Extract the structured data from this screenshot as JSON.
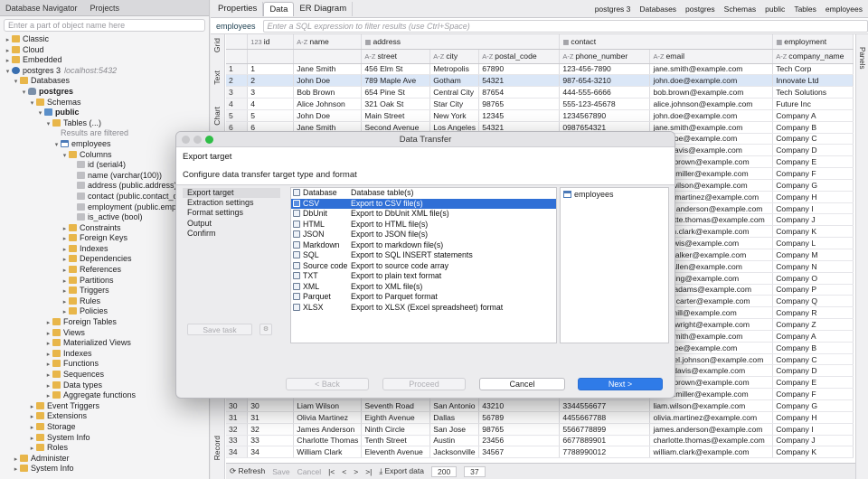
{
  "nav": {
    "tab_label": "Database Navigator",
    "tab2_label": "Projects",
    "search_placeholder": "Enter a part of object name here",
    "items": [
      {
        "depth": 0,
        "arrow": "▸",
        "icon": "folder",
        "label": "Classic",
        "interactable": true
      },
      {
        "depth": 0,
        "arrow": "▸",
        "icon": "folder",
        "label": "Cloud",
        "interactable": true
      },
      {
        "depth": 0,
        "arrow": "▸",
        "icon": "folder",
        "label": "Embedded",
        "interactable": true
      },
      {
        "depth": 0,
        "arrow": "▾",
        "icon": "conn",
        "label": "postgres 3",
        "extra": "localhost:5432",
        "interactable": true
      },
      {
        "depth": 1,
        "arrow": "▾",
        "icon": "folder",
        "label": "Databases",
        "interactable": true
      },
      {
        "depth": 2,
        "arrow": "▾",
        "icon": "db",
        "label": "postgres",
        "bold": true,
        "interactable": true
      },
      {
        "depth": 3,
        "arrow": "▾",
        "icon": "folder",
        "label": "Schemas",
        "interactable": true
      },
      {
        "depth": 4,
        "arrow": "▾",
        "icon": "schema",
        "label": "public",
        "bold": true,
        "interactable": true
      },
      {
        "depth": 5,
        "arrow": "▾",
        "icon": "folder",
        "label": "Tables (...)",
        "interactable": true
      },
      {
        "depth": 6,
        "arrow": "",
        "icon": "none",
        "label": "Results are filtered",
        "muted": true,
        "interactable": false
      },
      {
        "depth": 6,
        "arrow": "▾",
        "icon": "table",
        "label": "employees",
        "interactable": true
      },
      {
        "depth": 7,
        "arrow": "▾",
        "icon": "folder",
        "label": "Columns",
        "interactable": true
      },
      {
        "depth": 8,
        "arrow": "",
        "icon": "col",
        "label": "id (serial4)",
        "interactable": true
      },
      {
        "depth": 8,
        "arrow": "",
        "icon": "col",
        "label": "name (varchar(100))",
        "interactable": true
      },
      {
        "depth": 8,
        "arrow": "",
        "icon": "col",
        "label": "address (public.address)",
        "interactable": true
      },
      {
        "depth": 8,
        "arrow": "",
        "icon": "col",
        "label": "contact (public.contact_c",
        "interactable": true
      },
      {
        "depth": 8,
        "arrow": "",
        "icon": "col",
        "label": "employment (public.emplo",
        "interactable": true
      },
      {
        "depth": 8,
        "arrow": "",
        "icon": "col",
        "label": "is_active (bool)",
        "interactable": true
      },
      {
        "depth": 7,
        "arrow": "▸",
        "icon": "folder",
        "label": "Constraints",
        "interactable": true
      },
      {
        "depth": 7,
        "arrow": "▸",
        "icon": "folder",
        "label": "Foreign Keys",
        "interactable": true
      },
      {
        "depth": 7,
        "arrow": "▸",
        "icon": "folder",
        "label": "Indexes",
        "interactable": true
      },
      {
        "depth": 7,
        "arrow": "▸",
        "icon": "folder",
        "label": "Dependencies",
        "interactable": true
      },
      {
        "depth": 7,
        "arrow": "▸",
        "icon": "folder",
        "label": "References",
        "interactable": true
      },
      {
        "depth": 7,
        "arrow": "▸",
        "icon": "folder",
        "label": "Partitions",
        "interactable": true
      },
      {
        "depth": 7,
        "arrow": "▸",
        "icon": "folder",
        "label": "Triggers",
        "interactable": true
      },
      {
        "depth": 7,
        "arrow": "▸",
        "icon": "folder",
        "label": "Rules",
        "interactable": true
      },
      {
        "depth": 7,
        "arrow": "▸",
        "icon": "folder",
        "label": "Policies",
        "interactable": true
      },
      {
        "depth": 5,
        "arrow": "▸",
        "icon": "folder",
        "label": "Foreign Tables",
        "interactable": true
      },
      {
        "depth": 5,
        "arrow": "▸",
        "icon": "folder",
        "label": "Views",
        "interactable": true
      },
      {
        "depth": 5,
        "arrow": "▸",
        "icon": "folder",
        "label": "Materialized Views",
        "interactable": true
      },
      {
        "depth": 5,
        "arrow": "▸",
        "icon": "folder",
        "label": "Indexes",
        "interactable": true
      },
      {
        "depth": 5,
        "arrow": "▸",
        "icon": "folder",
        "label": "Functions",
        "interactable": true
      },
      {
        "depth": 5,
        "arrow": "▸",
        "icon": "folder",
        "label": "Sequences",
        "interactable": true
      },
      {
        "depth": 5,
        "arrow": "▸",
        "icon": "folder",
        "label": "Data types",
        "interactable": true
      },
      {
        "depth": 5,
        "arrow": "▸",
        "icon": "folder",
        "label": "Aggregate functions",
        "interactable": true
      },
      {
        "depth": 3,
        "arrow": "▸",
        "icon": "folder",
        "label": "Event Triggers",
        "interactable": true
      },
      {
        "depth": 3,
        "arrow": "▸",
        "icon": "folder",
        "label": "Extensions",
        "interactable": true
      },
      {
        "depth": 3,
        "arrow": "▸",
        "icon": "folder",
        "label": "Storage",
        "interactable": true
      },
      {
        "depth": 3,
        "arrow": "▸",
        "icon": "folder",
        "label": "System Info",
        "interactable": true
      },
      {
        "depth": 3,
        "arrow": "▸",
        "icon": "folder",
        "label": "Roles",
        "interactable": true
      },
      {
        "depth": 1,
        "arrow": "▸",
        "icon": "folder",
        "label": "Administer",
        "interactable": true
      },
      {
        "depth": 1,
        "arrow": "▸",
        "icon": "folder",
        "label": "System Info",
        "interactable": true
      }
    ]
  },
  "editor": {
    "tabs": [
      "Properties",
      "Data",
      "ER Diagram"
    ],
    "crumbs": [
      "postgres 3",
      "Databases",
      "postgres",
      "Schemas",
      "public",
      "Tables",
      "employees"
    ],
    "table_name": "employees",
    "filter_placeholder": "Enter a SQL expression to filter results (use Ctrl+Space)",
    "side_labels": [
      "Grid",
      "Text",
      "Chart"
    ],
    "record_label": "Record",
    "right_label": "Panels"
  },
  "grid": {
    "group_headers": [
      "id",
      "name",
      "address",
      "contact",
      "employment"
    ],
    "sub_headers": [
      "street",
      "city",
      "postal_code",
      "phone_number",
      "email",
      "company_name"
    ],
    "rows": [
      [
        "1",
        "Jane Smith",
        "456 Elm St",
        "Metropolis",
        "67890",
        "123-456-7890",
        "jane.smith@example.com",
        "Tech Corp"
      ],
      [
        "2",
        "John Doe",
        "789 Maple Ave",
        "Gotham",
        "54321",
        "987-654-3210",
        "john.doe@example.com",
        "Innovate Ltd"
      ],
      [
        "3",
        "Bob Brown",
        "654 Pine St",
        "Central City",
        "87654",
        "444-555-6666",
        "bob.brown@example.com",
        "Tech Solutions"
      ],
      [
        "4",
        "Alice Johnson",
        "321 Oak St",
        "Star City",
        "98765",
        "555-123-45678",
        "alice.johnson@example.com",
        "Future Inc"
      ],
      [
        "5",
        "John Doe",
        "Main Street",
        "New York",
        "12345",
        "1234567890",
        "john.doe@example.com",
        "Company A"
      ],
      [
        "6",
        "Jane Smith",
        "Second Avenue",
        "Los Angeles",
        "54321",
        "0987654321",
        "jane.smith@example.com",
        "Company B"
      ],
      [
        "7",
        "",
        "",
        "",
        "",
        "",
        "john.doe@example.com",
        "Company C"
      ],
      [
        "8",
        "",
        "",
        "",
        "",
        "",
        "jane.davis@example.com",
        "Company D"
      ],
      [
        "9",
        "",
        "",
        "",
        "",
        "",
        "david.brown@example.com",
        "Company E"
      ],
      [
        "10",
        "",
        "",
        "",
        "",
        "",
        "emilia.miller@example.com",
        "Company F"
      ],
      [
        "11",
        "",
        "",
        "",
        "",
        "",
        "chris.wilson@example.com",
        "Company G"
      ],
      [
        "12",
        "",
        "",
        "",
        "",
        "",
        "sarah.martinez@example.com",
        "Company H"
      ],
      [
        "13",
        "",
        "",
        "",
        "",
        "",
        "james.anderson@example.com",
        "Company I"
      ],
      [
        "14",
        "",
        "",
        "",
        "",
        "",
        "charlotte.thomas@example.com",
        "Company J"
      ],
      [
        "15",
        "",
        "",
        "",
        "",
        "",
        "william.clark@example.com",
        "Company K"
      ],
      [
        "16",
        "",
        "",
        "",
        "",
        "",
        "ella.lewis@example.com",
        "Company L"
      ],
      [
        "17",
        "",
        "",
        "",
        "",
        "",
        "alex.walker@example.com",
        "Company M"
      ],
      [
        "18",
        "",
        "",
        "",
        "",
        "",
        "sofia.allen@example.com",
        "Company N"
      ],
      [
        "19",
        "",
        "",
        "",
        "",
        "",
        "ryan.king@example.com",
        "Company O"
      ],
      [
        "20",
        "",
        "",
        "",
        "",
        "",
        "chloe.adams@example.com",
        "Company P"
      ],
      [
        "21",
        "",
        "",
        "",
        "",
        "",
        "daniel.carter@example.com",
        "Company Q"
      ],
      [
        "22",
        "",
        "",
        "",
        "",
        "",
        "olivia.hill@example.com",
        "Company R"
      ],
      [
        "23",
        "",
        "",
        "",
        "",
        "",
        "ethan.wright@example.com",
        "Company Z"
      ],
      [
        "24",
        "",
        "",
        "",
        "",
        "",
        "john.smith@example.com",
        "Company A"
      ],
      [
        "25",
        "",
        "",
        "",
        "",
        "",
        "jane.doe@example.com",
        "Company B"
      ],
      [
        "26",
        "",
        "",
        "",
        "",
        "",
        "michael.johnson@example.com",
        "Company C"
      ],
      [
        "27",
        "",
        "",
        "",
        "",
        "",
        "emily.davis@example.com",
        "Company D"
      ],
      [
        "28",
        "",
        "",
        "",
        "",
        "",
        "david.brown@example.com",
        "Company E"
      ],
      [
        "29",
        "",
        "",
        "",
        "",
        "",
        "emilia.miller@example.com",
        "Company F"
      ],
      [
        "30",
        "Liam Wilson",
        "Seventh Road",
        "San Antonio",
        "43210",
        "3344556677",
        "liam.wilson@example.com",
        "Company G"
      ],
      [
        "31",
        "Olivia Martinez",
        "Eighth Avenue",
        "Dallas",
        "56789",
        "4455667788",
        "olivia.martinez@example.com",
        "Company H"
      ],
      [
        "32",
        "James Anderson",
        "Ninth Circle",
        "San Jose",
        "98765",
        "5566778899",
        "james.anderson@example.com",
        "Company I"
      ],
      [
        "33",
        "Charlotte Thomas",
        "Tenth Street",
        "Austin",
        "23456",
        "6677889901",
        "charlotte.thomas@example.com",
        "Company J"
      ],
      [
        "34",
        "William Clark",
        "Eleventh Avenue",
        "Jacksonville",
        "34567",
        "7788990012",
        "william.clark@example.com",
        "Company K"
      ]
    ]
  },
  "status": {
    "refresh": "Refresh",
    "save": "Save",
    "cancel": "Cancel",
    "export": "Export data",
    "fetch_size": "200",
    "row_count": "37"
  },
  "dialog": {
    "title": "Data Transfer",
    "heading": "Export target",
    "subheading": "Configure data transfer target type and format",
    "steps": [
      "Export target",
      "Extraction settings",
      "Format settings",
      "Output",
      "Confirm"
    ],
    "save_task": "Save task",
    "formats": [
      {
        "name": "Database",
        "desc": "Database table(s)"
      },
      {
        "name": "CSV",
        "desc": "Export to CSV file(s)",
        "selected": true
      },
      {
        "name": "DbUnit",
        "desc": "Export to DbUnit XML file(s)"
      },
      {
        "name": "HTML",
        "desc": "Export to HTML file(s)"
      },
      {
        "name": "JSON",
        "desc": "Export to JSON file(s)"
      },
      {
        "name": "Markdown",
        "desc": "Export to markdown file(s)"
      },
      {
        "name": "SQL",
        "desc": "Export to SQL INSERT statements"
      },
      {
        "name": "Source code",
        "desc": "Export to source code array"
      },
      {
        "name": "TXT",
        "desc": "Export to plain text format"
      },
      {
        "name": "XML",
        "desc": "Export to XML file(s)"
      },
      {
        "name": "Parquet",
        "desc": "Export to Parquet format"
      },
      {
        "name": "XLSX",
        "desc": "Export to XLSX (Excel spreadsheet) format"
      }
    ],
    "objects": [
      "employees"
    ],
    "buttons": {
      "back": "< Back",
      "proceed": "Proceed",
      "cancel": "Cancel",
      "next": "Next >"
    }
  },
  "colors": {
    "accent": "#2f7be8",
    "selection": "#2f6fd6"
  }
}
